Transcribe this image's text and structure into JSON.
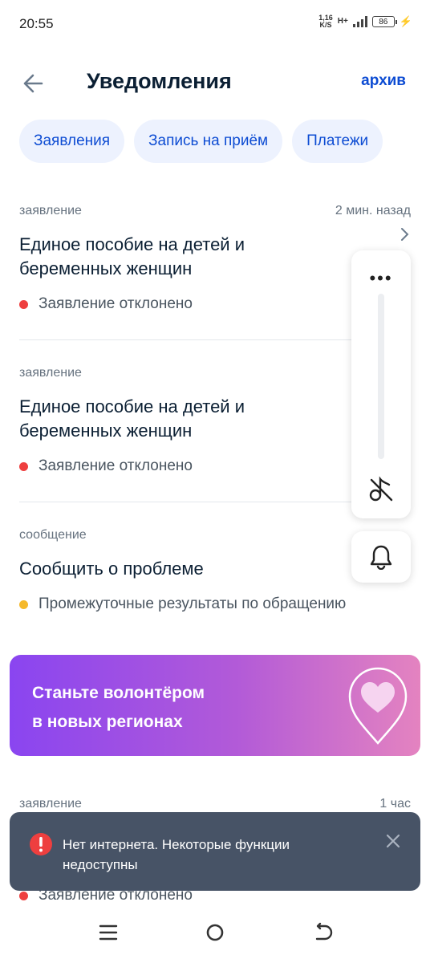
{
  "status": {
    "time": "20:55",
    "net_speed_value": "1,16",
    "net_speed_unit": "K/S",
    "network_type": "H+",
    "battery": "86"
  },
  "header": {
    "title": "Уведомления",
    "archive_label": "архив",
    "back_icon": "arrow-left-icon"
  },
  "filters": [
    "Заявления",
    "Запись на приём",
    "Платежи"
  ],
  "notifications": [
    {
      "type": "заявление",
      "time": "2 мин. назад",
      "title_line1": "Единое пособие на детей и",
      "title_line2": "беременных женщин",
      "status": "Заявление отклонено",
      "status_color": "#ee3f3f"
    },
    {
      "type": "заявление",
      "time": "",
      "title_line1": "Единое пособие на детей и",
      "title_line2": "беременных женщин",
      "status": "Заявление отклонено",
      "status_color": "#ee3f3f"
    },
    {
      "type": "сообщение",
      "time": "",
      "title_line1": "Сообщить о проблеме",
      "title_line2": "",
      "status": "Промежуточные результаты по обращению",
      "status_color": "#f5b92b"
    },
    {
      "type": "заявление",
      "time": "1 час",
      "status": "Заявление отклонено",
      "status_color": "#ee3f3f"
    }
  ],
  "banner": {
    "line1": "Станьте волонтёром",
    "line2": "в новых регионах"
  },
  "toast": {
    "line1": "Нет интернета. Некоторые функции",
    "line2": "недоступны"
  },
  "colors": {
    "accent": "#0d4cd3",
    "chip_bg": "#edf2fe",
    "toast_bg": "#475366",
    "error": "#ee3f3f",
    "warning": "#f5b92b"
  }
}
